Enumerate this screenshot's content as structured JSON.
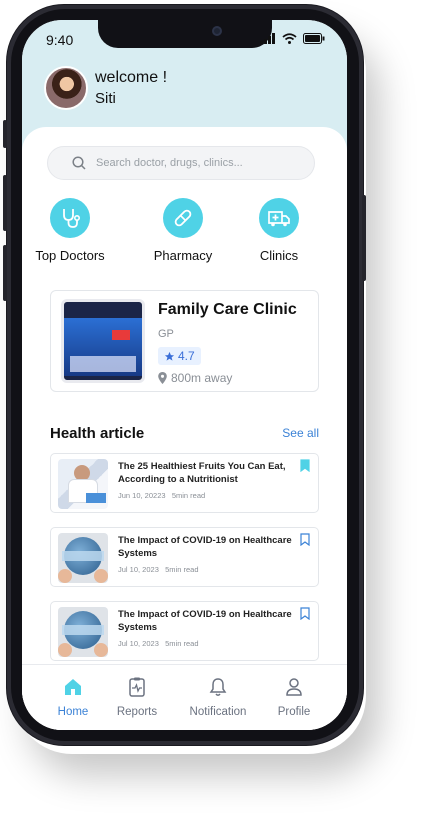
{
  "status": {
    "time": "9:40"
  },
  "header": {
    "welcome": "welcome !",
    "name": "Siti"
  },
  "search": {
    "placeholder": "Search doctor, drugs, clinics..."
  },
  "categories": [
    {
      "label": "Top Doctors",
      "icon": "stethoscope-icon"
    },
    {
      "label": "Pharmacy",
      "icon": "pill-icon"
    },
    {
      "label": "Clinics",
      "icon": "ambulance-icon"
    }
  ],
  "clinic": {
    "name": "Family Care Clinic",
    "type": "GP",
    "rating": "4.7",
    "distance": "800m away"
  },
  "articles_section": {
    "title": "Health article",
    "see_all": "See all"
  },
  "articles": [
    {
      "title": "The 25 Healthiest Fruits You Can Eat, According to a Nutritionist",
      "date": "Jun 10, 20223",
      "read": "5min read",
      "bookmarked": true
    },
    {
      "title": "The Impact of COVID-19 on Healthcare Systems",
      "date": "Jul 10, 2023",
      "read": "5min read",
      "bookmarked": false
    },
    {
      "title": "The Impact of COVID-19 on Healthcare Systems",
      "date": "Jul 10, 2023",
      "read": "5min read",
      "bookmarked": false
    }
  ],
  "tabs": [
    {
      "label": "Home",
      "icon": "home-icon",
      "active": true
    },
    {
      "label": "Reports",
      "icon": "report-icon",
      "active": false
    },
    {
      "label": "Notification",
      "icon": "bell-icon",
      "active": false
    },
    {
      "label": "Profile",
      "icon": "profile-icon",
      "active": false
    }
  ],
  "colors": {
    "accent": "#4fd2e6",
    "link": "#3b82d6",
    "header_bg": "#d8edf2"
  }
}
